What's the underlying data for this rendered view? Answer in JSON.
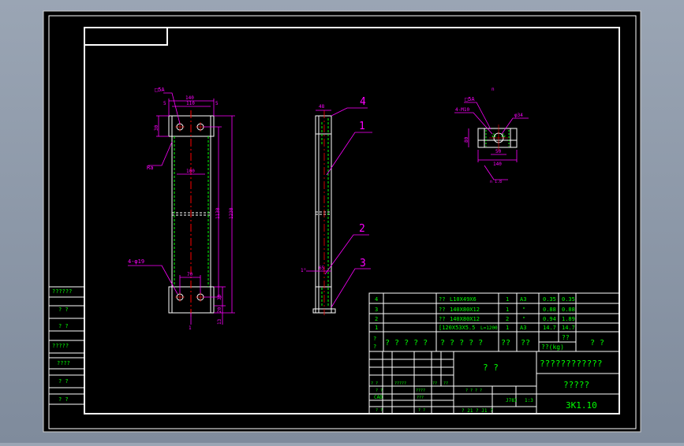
{
  "colors": {
    "viewport_bg": "#000000",
    "frame": "#ffffff",
    "dimension": "#ff00ff",
    "centerline": "#ff0000",
    "hidden_line": "#00ff00",
    "text": "#00ff00",
    "outer_bg": "#8b96a6"
  },
  "left_strip": {
    "labels": [
      "??????",
      "?  ?",
      "?  ?",
      "?????",
      "????",
      "?  ?",
      "?  ?"
    ]
  },
  "front_view": {
    "dims": {
      "top_overall": "140",
      "top_inner": "110",
      "top_left_edge": "5",
      "top_right_edge": "5",
      "top_height": "30",
      "hole_pitch_mid": "100",
      "height_inner": "1130",
      "height_overall": "1230",
      "bottom_spacing": "70",
      "bottom_h1": "30",
      "bottom_h2": "20",
      "bottom_h3": "13",
      "bottom_note": "1"
    },
    "notes": {
      "holes_top": "□5A",
      "left_symbol": "Ra",
      "holes_bottom": "4-φ19"
    }
  },
  "side_view": {
    "dims": {
      "top_width": "48",
      "mid_width": "65",
      "bottom_angle": "1°"
    },
    "leaders": {
      "part4": "4",
      "part1": "1",
      "part2": "2",
      "part3": "3"
    }
  },
  "detail_view": {
    "header": "n",
    "notes": {
      "weld": "□5A",
      "holes": "4-M10",
      "dia": "φ34"
    },
    "dims": {
      "height": "80",
      "inner_width": "50",
      "width": "140",
      "bottom_note": "n 1.8"
    }
  },
  "bom": {
    "rows": [
      {
        "no": "4",
        "code": "??",
        "spec": "L10X49X6",
        "qty": "1",
        "mat": "A3",
        "unit": "0.35",
        "total": "0.35"
      },
      {
        "no": "3",
        "code": "??",
        "spec": "140X80X12",
        "qty": "1",
        "mat": "\"",
        "unit": "0.88",
        "total": "0.88"
      },
      {
        "no": "2",
        "code": "??",
        "spec": "140X80X12",
        "qty": "2",
        "mat": "\"",
        "unit": "0.94",
        "total": "1.89"
      },
      {
        "no": "1",
        "code": "",
        "spec": "[120X53X5.5",
        "len": "L=1200",
        "qty": "1",
        "mat": "A3",
        "unit": "14.7",
        "total": "14.7"
      }
    ],
    "header": {
      "no": "?\n?",
      "code": "? ? ? ? ?",
      "name": "? ? ? ? ?",
      "qty": "??",
      "mat": "??",
      "weight_label": "??",
      "weight_unit": "??(kg)",
      "note": "?  ?"
    }
  },
  "title_block": {
    "company_title": "????????????",
    "drawing_name": "?????",
    "drawing_no": "3K1.10",
    "center_mark": "?    ?",
    "scale_label": "J78I",
    "scale_value": "1:3",
    "sheet_info": "?   21      ?   J1      ?",
    "grid_labels": [
      "?  ?",
      "?????",
      "??",
      "??",
      "? ? ? ?",
      "CAD",
      "????",
      "?  ?",
      "???",
      "?  ?",
      "?  ?"
    ]
  }
}
